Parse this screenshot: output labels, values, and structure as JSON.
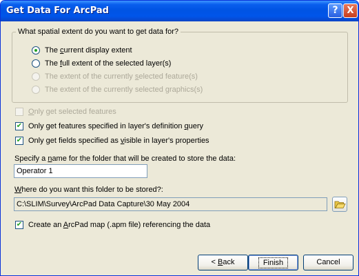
{
  "window": {
    "title": "Get Data For ArcPad"
  },
  "title_buttons": {
    "help": "?",
    "close": "X"
  },
  "extent_group": {
    "legend": "What spatial extent do you want to get data for?",
    "options": [
      {
        "pre": "The ",
        "key": "c",
        "post": "urrent display extent",
        "selected": true,
        "enabled": true
      },
      {
        "pre": "The ",
        "key": "f",
        "post": "ull extent of the selected layer(s)",
        "selected": false,
        "enabled": true
      },
      {
        "pre": "The extent of the currently ",
        "key": "s",
        "post": "elected feature(s)",
        "selected": false,
        "enabled": false
      },
      {
        "pre": "The extent of the currently selected ",
        "key": "g",
        "post": "raphics(s)",
        "selected": false,
        "enabled": false
      }
    ]
  },
  "checkboxes": [
    {
      "pre": "",
      "key": "O",
      "post": "nly get selected features",
      "checked": false,
      "enabled": false
    },
    {
      "pre": "Only get features specified in layer's definition ",
      "key": "q",
      "post": "uery",
      "checked": true,
      "enabled": true
    },
    {
      "pre": "Only get fields specified as ",
      "key": "v",
      "post": "isible in layer's properties",
      "checked": true,
      "enabled": true
    }
  ],
  "folder_name": {
    "label_pre": "Specify a ",
    "label_key": "n",
    "label_post": "ame for the folder that will be created to store the data:",
    "value": "Operator 1"
  },
  "folder_location": {
    "label_pre": "",
    "label_key": "W",
    "label_post": "here do you want this folder to be stored?:",
    "value": "C:\\SLIM\\Survey\\ArcPad Data Capture\\30 May 2004"
  },
  "create_map": {
    "pre": "Create an ",
    "key": "A",
    "post": "rcPad map (.apm file) referencing the data",
    "checked": true
  },
  "buttons": {
    "back_pre": "< ",
    "back_key": "B",
    "back_post": "ack",
    "finish": "Finish",
    "cancel": "Cancel"
  },
  "colors": {
    "titlebar": "#0054E3",
    "dialog_bg": "#ECE9D8",
    "check_mark": "#21A121",
    "disabled_text": "#ACA899"
  }
}
